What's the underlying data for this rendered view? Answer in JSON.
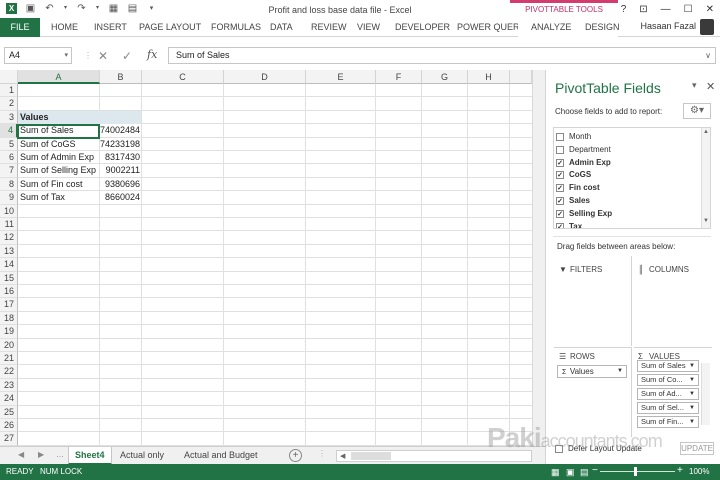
{
  "title_bar": {
    "window_title": "Profit and loss base data file - Excel",
    "contextual_group": "PIVOTTABLE TOOLS",
    "controls": [
      "?",
      "⊡",
      "—",
      "☐",
      "✕"
    ],
    "qat_icons": [
      "excel-logo-icon",
      "save-icon",
      "undo-icon",
      "redo-icon",
      "table-icon",
      "print-preview-icon",
      "customize-qat-icon"
    ]
  },
  "ribbon": {
    "tabs": [
      "FILE",
      "HOME",
      "INSERT",
      "PAGE LAYOUT",
      "FORMULAS",
      "DATA",
      "REVIEW",
      "VIEW",
      "DEVELOPER",
      "POWER QUERY"
    ],
    "context_tabs": [
      "ANALYZE",
      "DESIGN"
    ],
    "user": "Hasaan Fazal",
    "accent": "#217346"
  },
  "formula_bar": {
    "name_box": "A4",
    "formula": "Sum of Sales",
    "fx": "fx"
  },
  "sheet": {
    "columns": [
      "A",
      "B",
      "C",
      "D",
      "E",
      "F",
      "G",
      "H"
    ],
    "selected_col": "A",
    "rows": [
      "1",
      "2",
      "3",
      "4",
      "5",
      "6",
      "7",
      "8",
      "9",
      "10",
      "11",
      "12",
      "13",
      "14",
      "15",
      "16",
      "17",
      "18",
      "19",
      "20",
      "21",
      "22",
      "23",
      "24",
      "25",
      "26",
      "27"
    ],
    "selected_row": "4",
    "pivot_header": "Values",
    "pivot_rows": [
      {
        "label": "Sum of Sales",
        "value": "74002484"
      },
      {
        "label": "Sum of CoGS",
        "value": "74233198"
      },
      {
        "label": "Sum of Admin Exp",
        "value": "8317430"
      },
      {
        "label": "Sum of Selling Exp",
        "value": "9002211"
      },
      {
        "label": "Sum of Fin cost",
        "value": "9380696"
      },
      {
        "label": "Sum of Tax",
        "value": "8660024"
      }
    ]
  },
  "sheet_tabs": {
    "tabs": [
      "Sheet4",
      "Actual only",
      "Actual and Budget"
    ],
    "active": "Sheet4",
    "add": "+"
  },
  "status_bar": {
    "ready": "READY",
    "num_lock": "NUM LOCK",
    "zoom": "100%",
    "zoom_level_pct": 100,
    "zoom_minus": "−",
    "zoom_plus": "+"
  },
  "pivot_pane": {
    "title": "PivotTable Fields",
    "choose_label": "Choose fields to add to report:",
    "fields": [
      {
        "name": "Month",
        "checked": false
      },
      {
        "name": "Department",
        "checked": false
      },
      {
        "name": "Admin Exp",
        "checked": true
      },
      {
        "name": "CoGS",
        "checked": true
      },
      {
        "name": "Fin cost",
        "checked": true
      },
      {
        "name": "Sales",
        "checked": true
      },
      {
        "name": "Selling Exp",
        "checked": true
      },
      {
        "name": "Tax",
        "checked": true
      }
    ],
    "drag_label": "Drag fields between areas below:",
    "areas": {
      "filters": "FILTERS",
      "columns": "COLUMNS",
      "rows": "ROWS",
      "values": "VALUES"
    },
    "rows_item": "Values",
    "values_items": [
      "Sum of Sales",
      "Sum of Co...",
      "Sum of Ad...",
      "Sum of Sel...",
      "Sum of Fin..."
    ],
    "defer_label": "Defer Layout Update",
    "update_button": "UPDATE"
  },
  "watermark": {
    "brand": "Paki",
    "rest": "accountants.com"
  }
}
